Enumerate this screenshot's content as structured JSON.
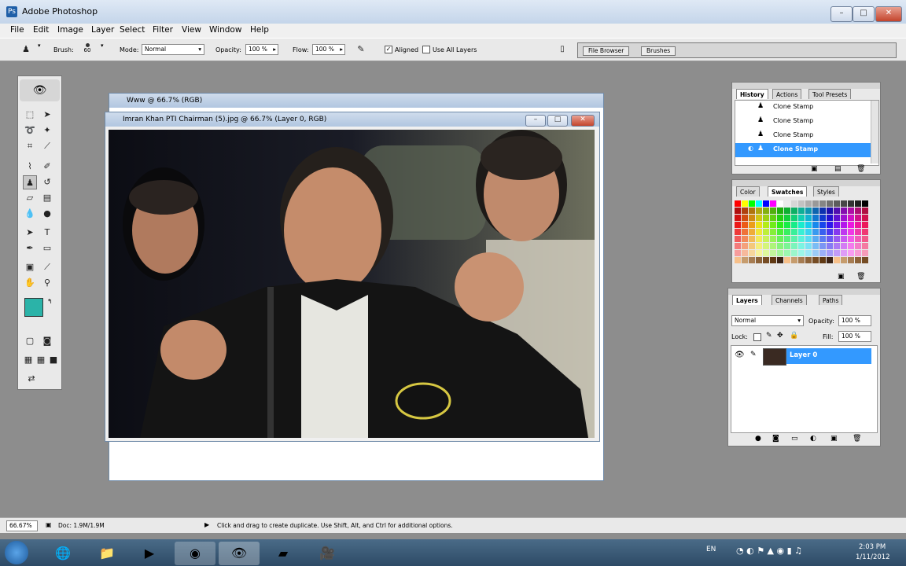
{
  "window": {
    "title": "Adobe Photoshop"
  },
  "menu": [
    "File",
    "Edit",
    "Image",
    "Layer",
    "Select",
    "Filter",
    "View",
    "Window",
    "Help"
  ],
  "options": {
    "brush_label": "Brush:",
    "brush_size": "60",
    "mode_label": "Mode:",
    "mode_value": "Normal",
    "opacity_label": "Opacity:",
    "opacity_value": "100 %",
    "flow_label": "Flow:",
    "flow_value": "100 %",
    "aligned_label": "Aligned",
    "aligned_checked": true,
    "use_all_layers_label": "Use All Layers",
    "use_all_layers_checked": false,
    "palette_well_tabs": [
      "File Browser",
      "Brushes"
    ]
  },
  "documents": {
    "back_title": "Www @ 66.7% (RGB)",
    "front_title": "Imran Khan PTI Chairman (5).jpg @ 66.7% (Layer 0, RGB)"
  },
  "history": {
    "tabs": [
      "History",
      "Actions",
      "Tool Presets"
    ],
    "items": [
      "Clone Stamp",
      "Clone Stamp",
      "Clone Stamp",
      "Clone Stamp"
    ],
    "selected_index": 3
  },
  "swatches": {
    "tabs": [
      "Color",
      "Swatches",
      "Styles"
    ]
  },
  "layers": {
    "tabs": [
      "Layers",
      "Channels",
      "Paths"
    ],
    "blend_mode": "Normal",
    "opacity_label": "Opacity:",
    "opacity_value": "100 %",
    "lock_label": "Lock:",
    "fill_label": "Fill:",
    "fill_value": "100 %",
    "layer_name": "Layer 0"
  },
  "status": {
    "zoom": "66.67%",
    "doc_size": "Doc: 1.9M/1.9M",
    "hint": "Click and drag to create duplicate. Use Shift, Alt, and Ctrl for additional options."
  },
  "taskbar": {
    "lang": "EN",
    "time": "2:03 PM",
    "date": "1/11/2012"
  },
  "colors": {
    "foreground": "#2bb3a8",
    "background": "#ffffff",
    "selection": "#3399ff",
    "workspace": "#8d8d8d"
  }
}
